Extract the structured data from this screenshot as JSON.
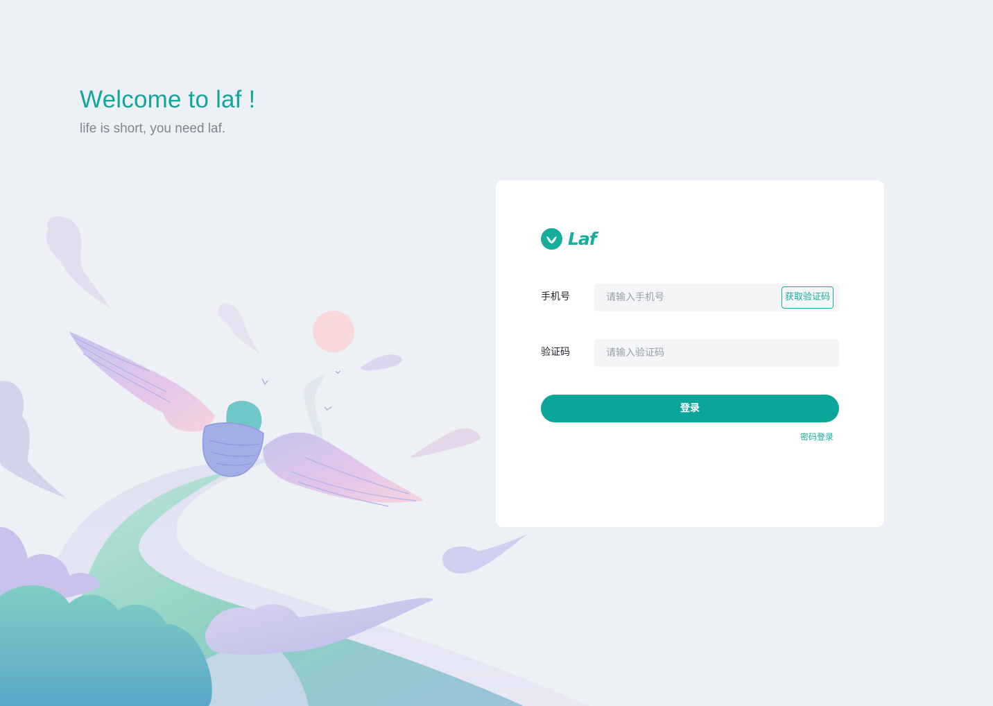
{
  "welcome": {
    "title": "Welcome to laf !",
    "subtitle": "life is short, you need laf."
  },
  "logo": {
    "text": "Laf",
    "icon": "laf-logo-icon"
  },
  "form": {
    "phone_label": "手机号",
    "phone_placeholder": "请输入手机号",
    "get_code_label": "获取验证码",
    "code_label": "验证码",
    "code_placeholder": "请输入验证码"
  },
  "actions": {
    "login_label": "登录",
    "password_login_label": "密码登录"
  },
  "colors": {
    "accent": "#0aa699",
    "background": "#edf0f5",
    "card": "#ffffff"
  }
}
